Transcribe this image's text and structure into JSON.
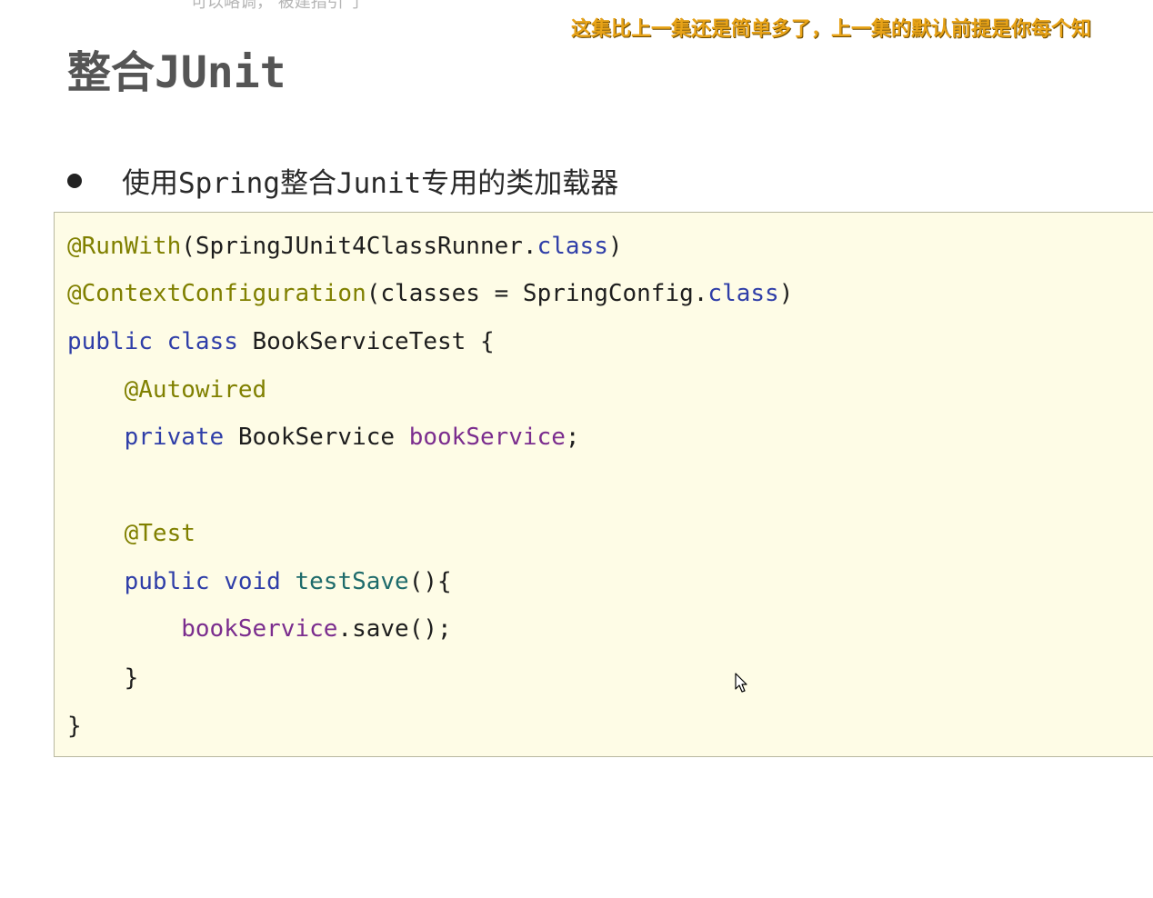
{
  "top_fragment": "可以略调，  被建指引  了",
  "overlay_caption": "这集比上一集还是简单多了，上一集的默认前提是你每个知",
  "slide": {
    "title": "整合JUnit",
    "bullet": "使用Spring整合Junit专用的类加载器"
  },
  "code": {
    "l1": {
      "ann": "@RunWith",
      "rest": "(SpringJUnit4ClassRunner.",
      "kw": "class",
      "end": ")"
    },
    "l2": {
      "ann": "@ContextConfiguration",
      "rest": "(classes = SpringConfig.",
      "kw": "class",
      "end": ")"
    },
    "l3": {
      "kw1": "public",
      "kw2": "class",
      "rest": "BookServiceTest {"
    },
    "l4": {
      "ann": "@Autowired"
    },
    "l5": {
      "kw": "private",
      "type": "BookService",
      "field": "bookService",
      "end": ";"
    },
    "l6": {
      "ann": "@Test"
    },
    "l7": {
      "kw1": "public",
      "kw2": "void",
      "method": "testSave",
      "end": "(){"
    },
    "l8": {
      "field": "bookService",
      "rest": ".save();"
    },
    "l9": {
      "text": "}"
    },
    "l10": {
      "text": "}"
    }
  },
  "colors": {
    "annotation": "#808000",
    "keyword": "#2f3ea8",
    "field": "#7b2d8e",
    "method": "#1e6b6b",
    "code_background": "#fefce6",
    "caption": "#e8a317"
  },
  "icons": {
    "cursor": "mouse-pointer-icon"
  }
}
